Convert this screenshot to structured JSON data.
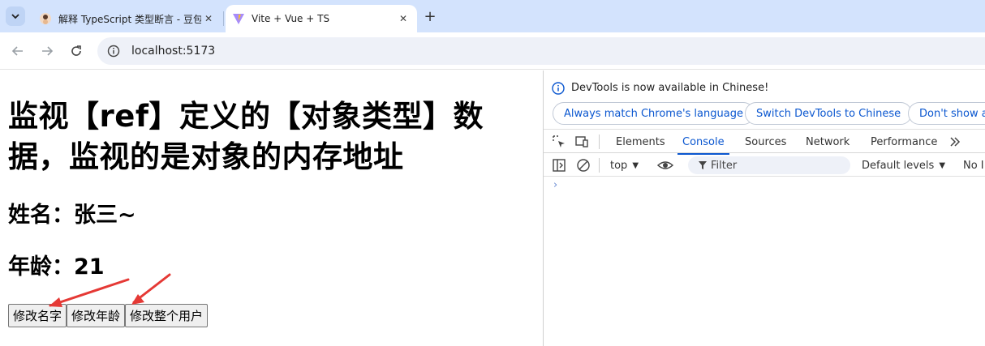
{
  "browser": {
    "tabs": [
      {
        "title": "解释 TypeScript 类型断言 - 豆包",
        "active": false
      },
      {
        "title": "Vite + Vue + TS",
        "active": true
      }
    ],
    "url": "localhost:5173"
  },
  "page": {
    "heading": "监视【ref】定义的【对象类型】数据，监视的是对象的内存地址",
    "name_line": "姓名：张三~",
    "age_line": "年龄：21",
    "buttons": {
      "change_name": "修改名字",
      "change_age": "修改年龄",
      "change_user": "修改整个用户"
    }
  },
  "devtools": {
    "info_text": "DevTools is now available in Chinese!",
    "pills": {
      "match_language": "Always match Chrome's language",
      "switch_chinese": "Switch DevTools to Chinese",
      "dont_show": "Don't show ag"
    },
    "tabs": {
      "elements": "Elements",
      "console": "Console",
      "sources": "Sources",
      "network": "Network",
      "performance": "Performance"
    },
    "console_bar": {
      "context": "top",
      "filter_placeholder": "Filter",
      "levels": "Default levels",
      "issues": "No I"
    },
    "prompt": "›"
  },
  "colors": {
    "accent": "#0b57d0",
    "tabstrip": "#d3e3fd",
    "annotation_arrow": "#e53935"
  }
}
